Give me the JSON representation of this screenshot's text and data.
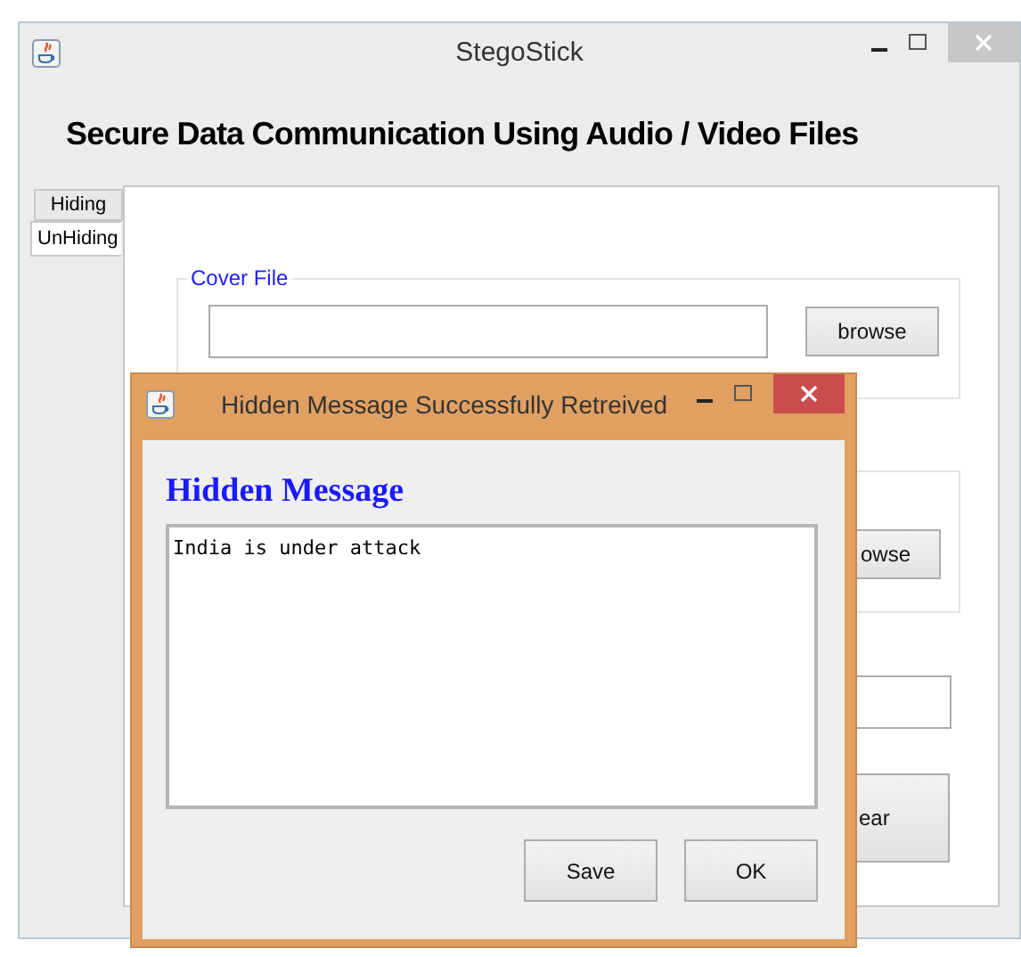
{
  "window": {
    "title": "StegoStick"
  },
  "heading": "Secure Data Communication Using Audio / Video Files",
  "tabs": [
    {
      "label": "Hiding",
      "selected": false
    },
    {
      "label": "UnHiding",
      "selected": true
    }
  ],
  "cover_file": {
    "legend": "Cover File",
    "button": "browse"
  },
  "group_2": {
    "button_partial": "owse"
  },
  "button_partial": "ear",
  "dialog": {
    "title": "Hidden Message Successfully Retreived",
    "heading": "Hidden Message",
    "message": "India is under attack",
    "buttons": [
      "Save",
      "OK"
    ]
  }
}
